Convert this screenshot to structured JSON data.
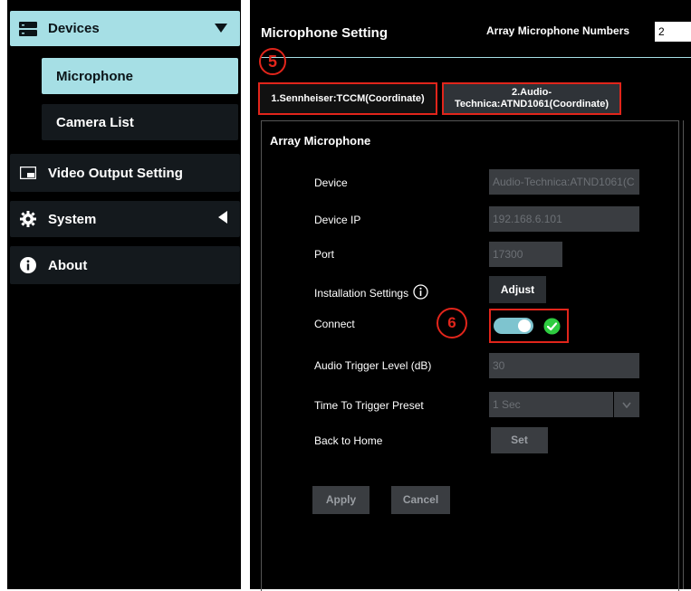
{
  "sidebar": {
    "devices": {
      "label": "Devices",
      "icon": "server-icon"
    },
    "microphone": {
      "label": "Microphone"
    },
    "camera_list": {
      "label": "Camera List"
    },
    "video_output": {
      "label": "Video Output Setting",
      "icon": "monitor-icon"
    },
    "system": {
      "label": "System",
      "icon": "gear-icon"
    },
    "about": {
      "label": "About",
      "icon": "info-icon"
    }
  },
  "header": {
    "title": "Microphone Setting",
    "array_label": "Array Microphone Numbers",
    "array_value": "2"
  },
  "tabs": [
    {
      "label": "1.Sennheiser:TCCM(Coordinate)"
    },
    {
      "label_line1": "2.Audio-",
      "label_line2": "Technica:ATND1061(Coordinate)"
    }
  ],
  "panel": {
    "title": "Array Microphone",
    "device": {
      "label": "Device",
      "value": "Audio-Technica:ATND1061(C"
    },
    "device_ip": {
      "label": "Device IP",
      "value": "192.168.6.101"
    },
    "port": {
      "label": "Port",
      "value": "17300"
    },
    "installation": {
      "label": "Installation Settings",
      "button": "Adjust"
    },
    "connect": {
      "label": "Connect",
      "state": "on"
    },
    "trigger_level": {
      "label": "Audio Trigger Level (dB)",
      "value": "30"
    },
    "trigger_preset": {
      "label": "Time To Trigger Preset",
      "value": "1 Sec"
    },
    "back_home": {
      "label": "Back to Home",
      "button": "Set"
    },
    "apply": "Apply",
    "cancel": "Cancel"
  },
  "annotations": {
    "step5": "5",
    "step6": "6"
  },
  "colors": {
    "accent": "#a6dfe5",
    "highlight": "#e1251b",
    "success": "#2ecc40"
  }
}
